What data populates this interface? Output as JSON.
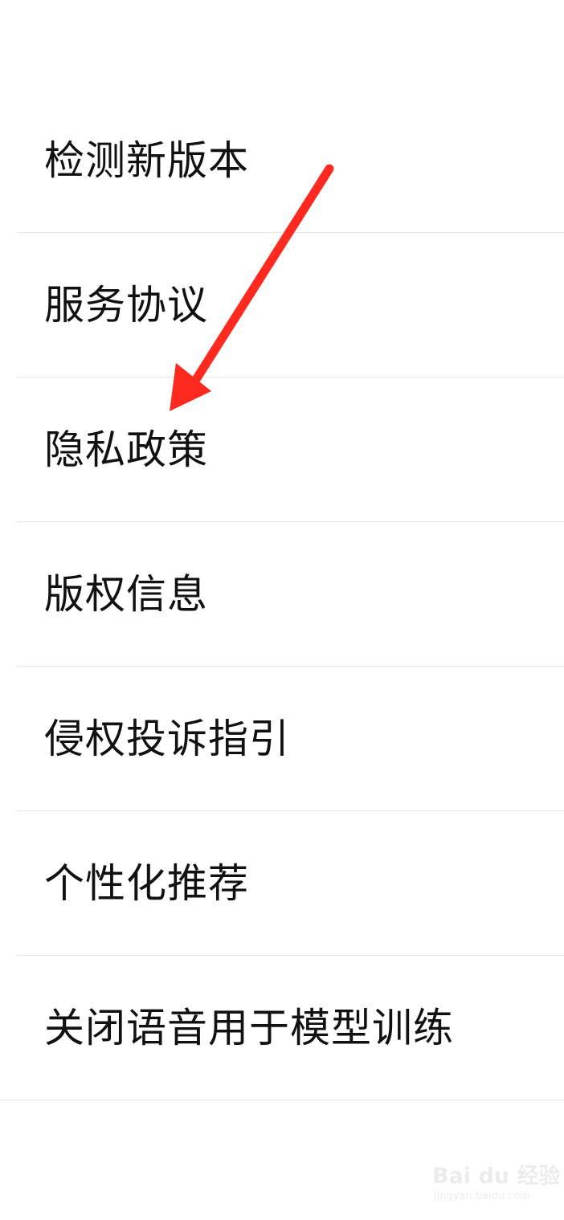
{
  "menu": {
    "items": [
      {
        "label": "检测新版本"
      },
      {
        "label": "服务协议"
      },
      {
        "label": "隐私政策"
      },
      {
        "label": "版权信息"
      },
      {
        "label": "侵权投诉指引"
      },
      {
        "label": "个性化推荐"
      },
      {
        "label": "关闭语音用于模型训练"
      }
    ]
  },
  "annotation": {
    "type": "arrow",
    "color": "#ff2a1f",
    "points_to": "隐私政策"
  },
  "watermark": {
    "logo_text": "Bai du 经验",
    "paw_icon": "paw-icon",
    "url": "jingyan.baidu.com"
  }
}
